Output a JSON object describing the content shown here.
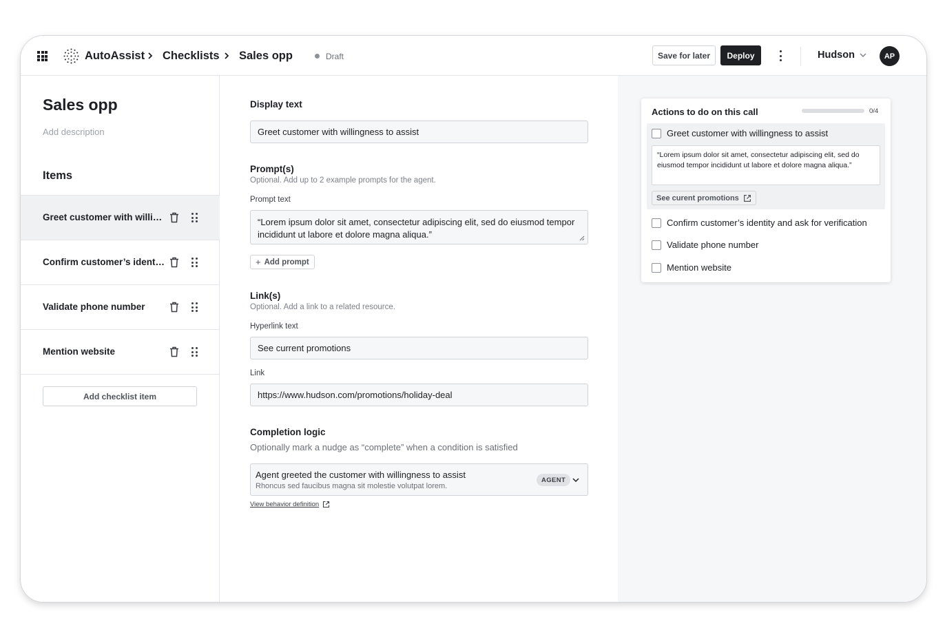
{
  "header": {
    "app_name": "AutoAssist",
    "breadcrumbs": [
      "Checklists",
      "Sales opp"
    ],
    "status": "Draft",
    "save_label": "Save for later",
    "deploy_label": "Deploy",
    "org_name": "Hudson",
    "avatar_initials": "AP"
  },
  "sidebar": {
    "title": "Sales opp",
    "description_placeholder": "Add description",
    "items_heading": "Items",
    "items": [
      {
        "label": "Greet customer with willingness to assist"
      },
      {
        "label": "Confirm customer’s identity and ask for verification"
      },
      {
        "label": "Validate phone number"
      },
      {
        "label": "Mention website"
      }
    ],
    "add_item_label": "Add checklist item"
  },
  "form": {
    "display_text": {
      "label": "Display text",
      "value": "Greet customer with willingness to assist"
    },
    "prompts": {
      "label": "Prompt(s)",
      "help": "Optional. Add up to 2 example prompts for the agent.",
      "sublabel": "Prompt text",
      "value": "“Lorem ipsum dolor sit amet, consectetur adipiscing elit, sed do eiusmod tempor incididunt ut labore et dolore magna aliqua.”",
      "add_label": "Add prompt"
    },
    "links": {
      "label": "Link(s)",
      "help": "Optional. Add a link to a related resource.",
      "hyperlink_label": "Hyperlink text",
      "hyperlink_value": "See current promotions",
      "link_label": "Link",
      "link_value": "https://www.hudson.com/promotions/holiday-deal"
    },
    "completion": {
      "label": "Completion logic",
      "help": "Optionally mark a nudge as “complete” when a condition is satisfied",
      "selected_title": "Agent greeted the customer with willingness to assist",
      "selected_subtitle": "Rhoncus sed faucibus magna sit molestie volutpat lorem.",
      "badge": "AGENT",
      "view_link": "View behavior definition"
    }
  },
  "preview": {
    "title": "Actions to do on this call",
    "progress_text": "0/4",
    "progress_fraction": 0,
    "tasks": [
      {
        "label": "Greet customer with willingness to assist",
        "checked": false
      },
      {
        "label": "Confirm customer’s identity and ask for verification",
        "checked": false
      },
      {
        "label": "Validate phone number",
        "checked": false
      },
      {
        "label": "Mention website",
        "checked": false
      }
    ],
    "expanded_quote": "“Lorem ipsum dolor sit amet, consectetur adipiscing elit, sed do eiusmod tempor incididunt ut labore et dolore magna aliqua.”",
    "expanded_link": "See curent promotions"
  },
  "colors": {
    "primary_dark": "#1f2024",
    "selected_row_bg": "#f0f1f3",
    "preview_bg": "#f6f7f9"
  },
  "icons": {
    "apps": "apps-grid-icon",
    "logo": "autoassist-logo-icon",
    "breadcrumb_separator": "chevron-right-icon",
    "more": "kebab-menu-icon",
    "org_dropdown": "chevron-down-icon",
    "delete": "trash-icon",
    "reorder": "drag-handle-icon",
    "add": "plus-icon",
    "external_link": "external-link-icon"
  }
}
